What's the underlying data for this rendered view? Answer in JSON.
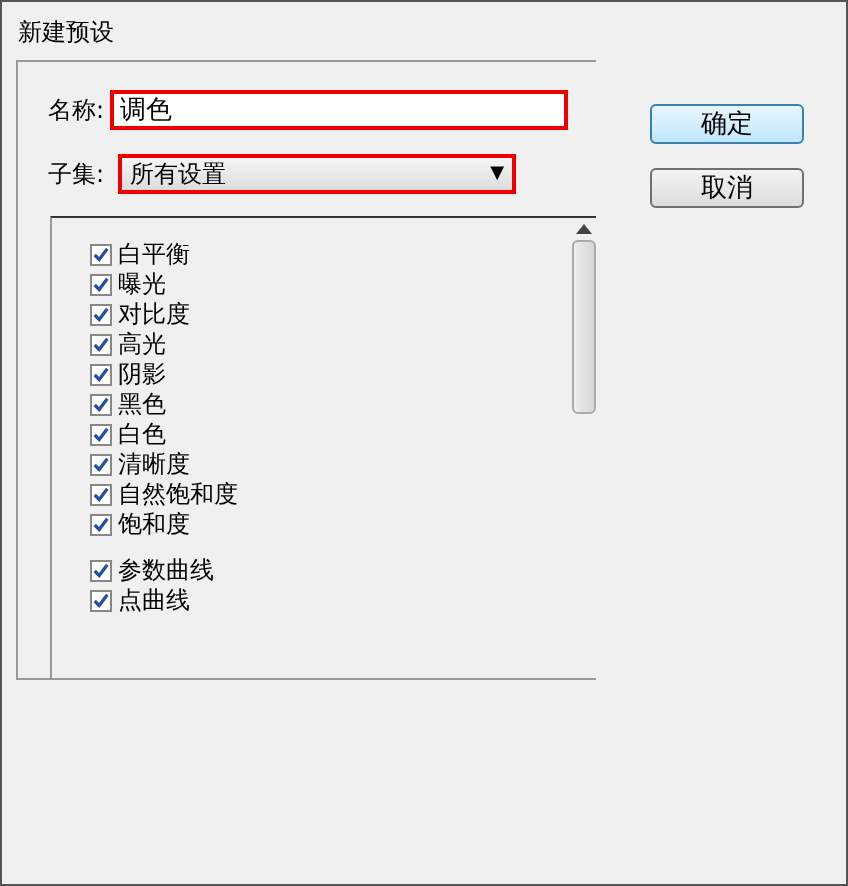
{
  "window": {
    "title": "新建预设"
  },
  "name_field": {
    "label": "名称:",
    "value": "调色"
  },
  "subset": {
    "label": "子集:",
    "value": "所有设置",
    "caret": "▼"
  },
  "buttons": [
    {
      "label": "确定",
      "default": true
    },
    {
      "label": "取消",
      "default": false
    }
  ],
  "groups": [
    {
      "items": [
        {
          "label": "白平衡",
          "checked": true
        },
        {
          "label": "曝光",
          "checked": true
        },
        {
          "label": "对比度",
          "checked": true
        },
        {
          "label": "高光",
          "checked": true
        },
        {
          "label": "阴影",
          "checked": true
        },
        {
          "label": "黑色",
          "checked": true
        },
        {
          "label": "白色",
          "checked": true
        },
        {
          "label": "清晰度",
          "checked": true
        },
        {
          "label": "自然饱和度",
          "checked": true
        },
        {
          "label": "饱和度",
          "checked": true
        }
      ]
    },
    {
      "items": [
        {
          "label": "参数曲线",
          "checked": true
        },
        {
          "label": "点曲线",
          "checked": true
        }
      ]
    }
  ]
}
